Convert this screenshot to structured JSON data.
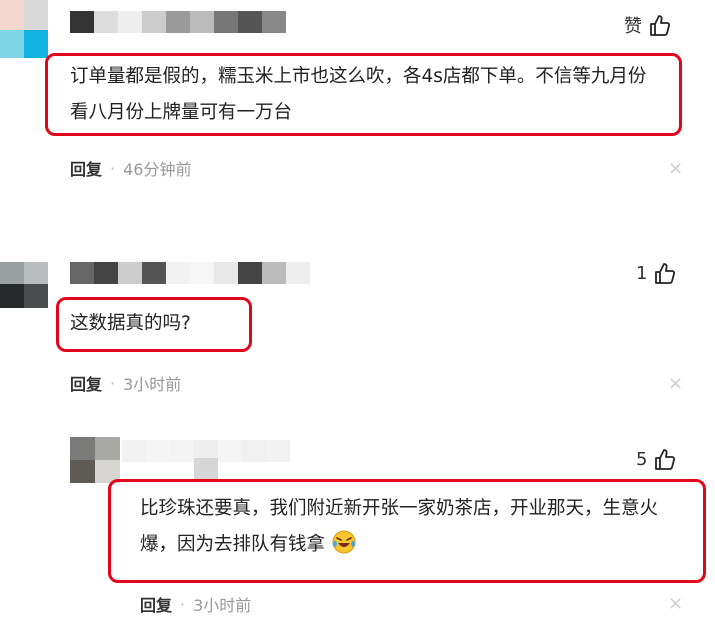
{
  "comments": [
    {
      "like_label": "赞",
      "text": "订单量都是假的，糯玉米上市也这么吹，各4s店都下单。不信等九月份看八月份上牌量可有一万台",
      "reply_label": "回复",
      "time": "46分钟前"
    },
    {
      "like_label": "1",
      "text": "这数据真的吗?",
      "reply_label": "回复",
      "time": "3小时前"
    },
    {
      "like_label": "5",
      "text": "比珍珠还要真，我们附近新开张一家奶茶店，开业那天，生意火爆，因为去排队有钱拿",
      "reply_label": "回复",
      "time": "3小时前"
    }
  ],
  "icons": {
    "like": "thumbs-up-icon",
    "close": "close-icon",
    "emoji": "laughing-crying-emoji"
  },
  "colors": {
    "highlight": "#e1061c",
    "meta_text": "#999999"
  }
}
